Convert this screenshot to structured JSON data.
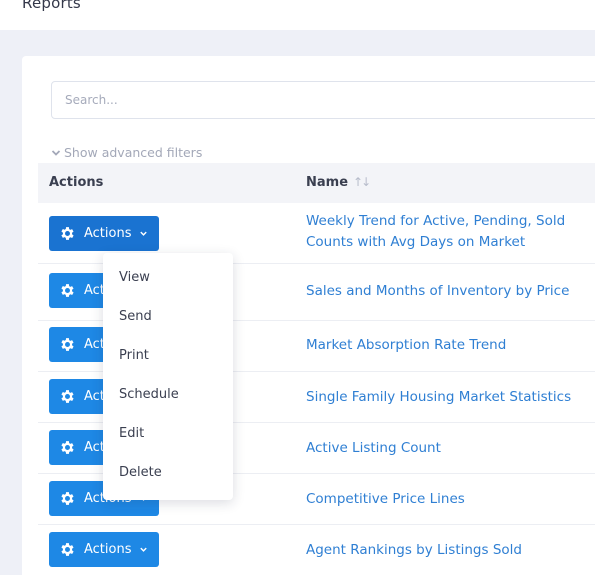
{
  "page": {
    "title": "Reports"
  },
  "search": {
    "placeholder": "Search..."
  },
  "filters": {
    "toggle_label": "Show advanced filters"
  },
  "table": {
    "headers": {
      "actions": "Actions",
      "name": "Name"
    },
    "rows": [
      {
        "action_label": "Actions",
        "name": "Weekly Trend for Active, Pending, Sold Counts with Avg Days on Market"
      },
      {
        "action_label": "Actions",
        "name": "Sales and Months of Inventory by Price"
      },
      {
        "action_label": "Actions",
        "name": "Market Absorption Rate Trend"
      },
      {
        "action_label": "Actions",
        "name": "Single Family Housing Market Statistics"
      },
      {
        "action_label": "Actions",
        "name": "Active Listing Count"
      },
      {
        "action_label": "Actions",
        "name": "Competitive Price Lines"
      },
      {
        "action_label": "Actions",
        "name": "Agent Rankings by Listings Sold"
      }
    ]
  },
  "actions_menu": {
    "items": [
      "View",
      "Send",
      "Print",
      "Schedule",
      "Edit",
      "Delete"
    ]
  },
  "colors": {
    "accent": "#1e88e5",
    "link": "#2f7fd3",
    "background": "#eef0f7"
  },
  "icons": {
    "row_action": "gear-icon",
    "dropdown": "chevron-down-icon",
    "sort": "sort-icon",
    "filters": "chevron-down-icon"
  }
}
